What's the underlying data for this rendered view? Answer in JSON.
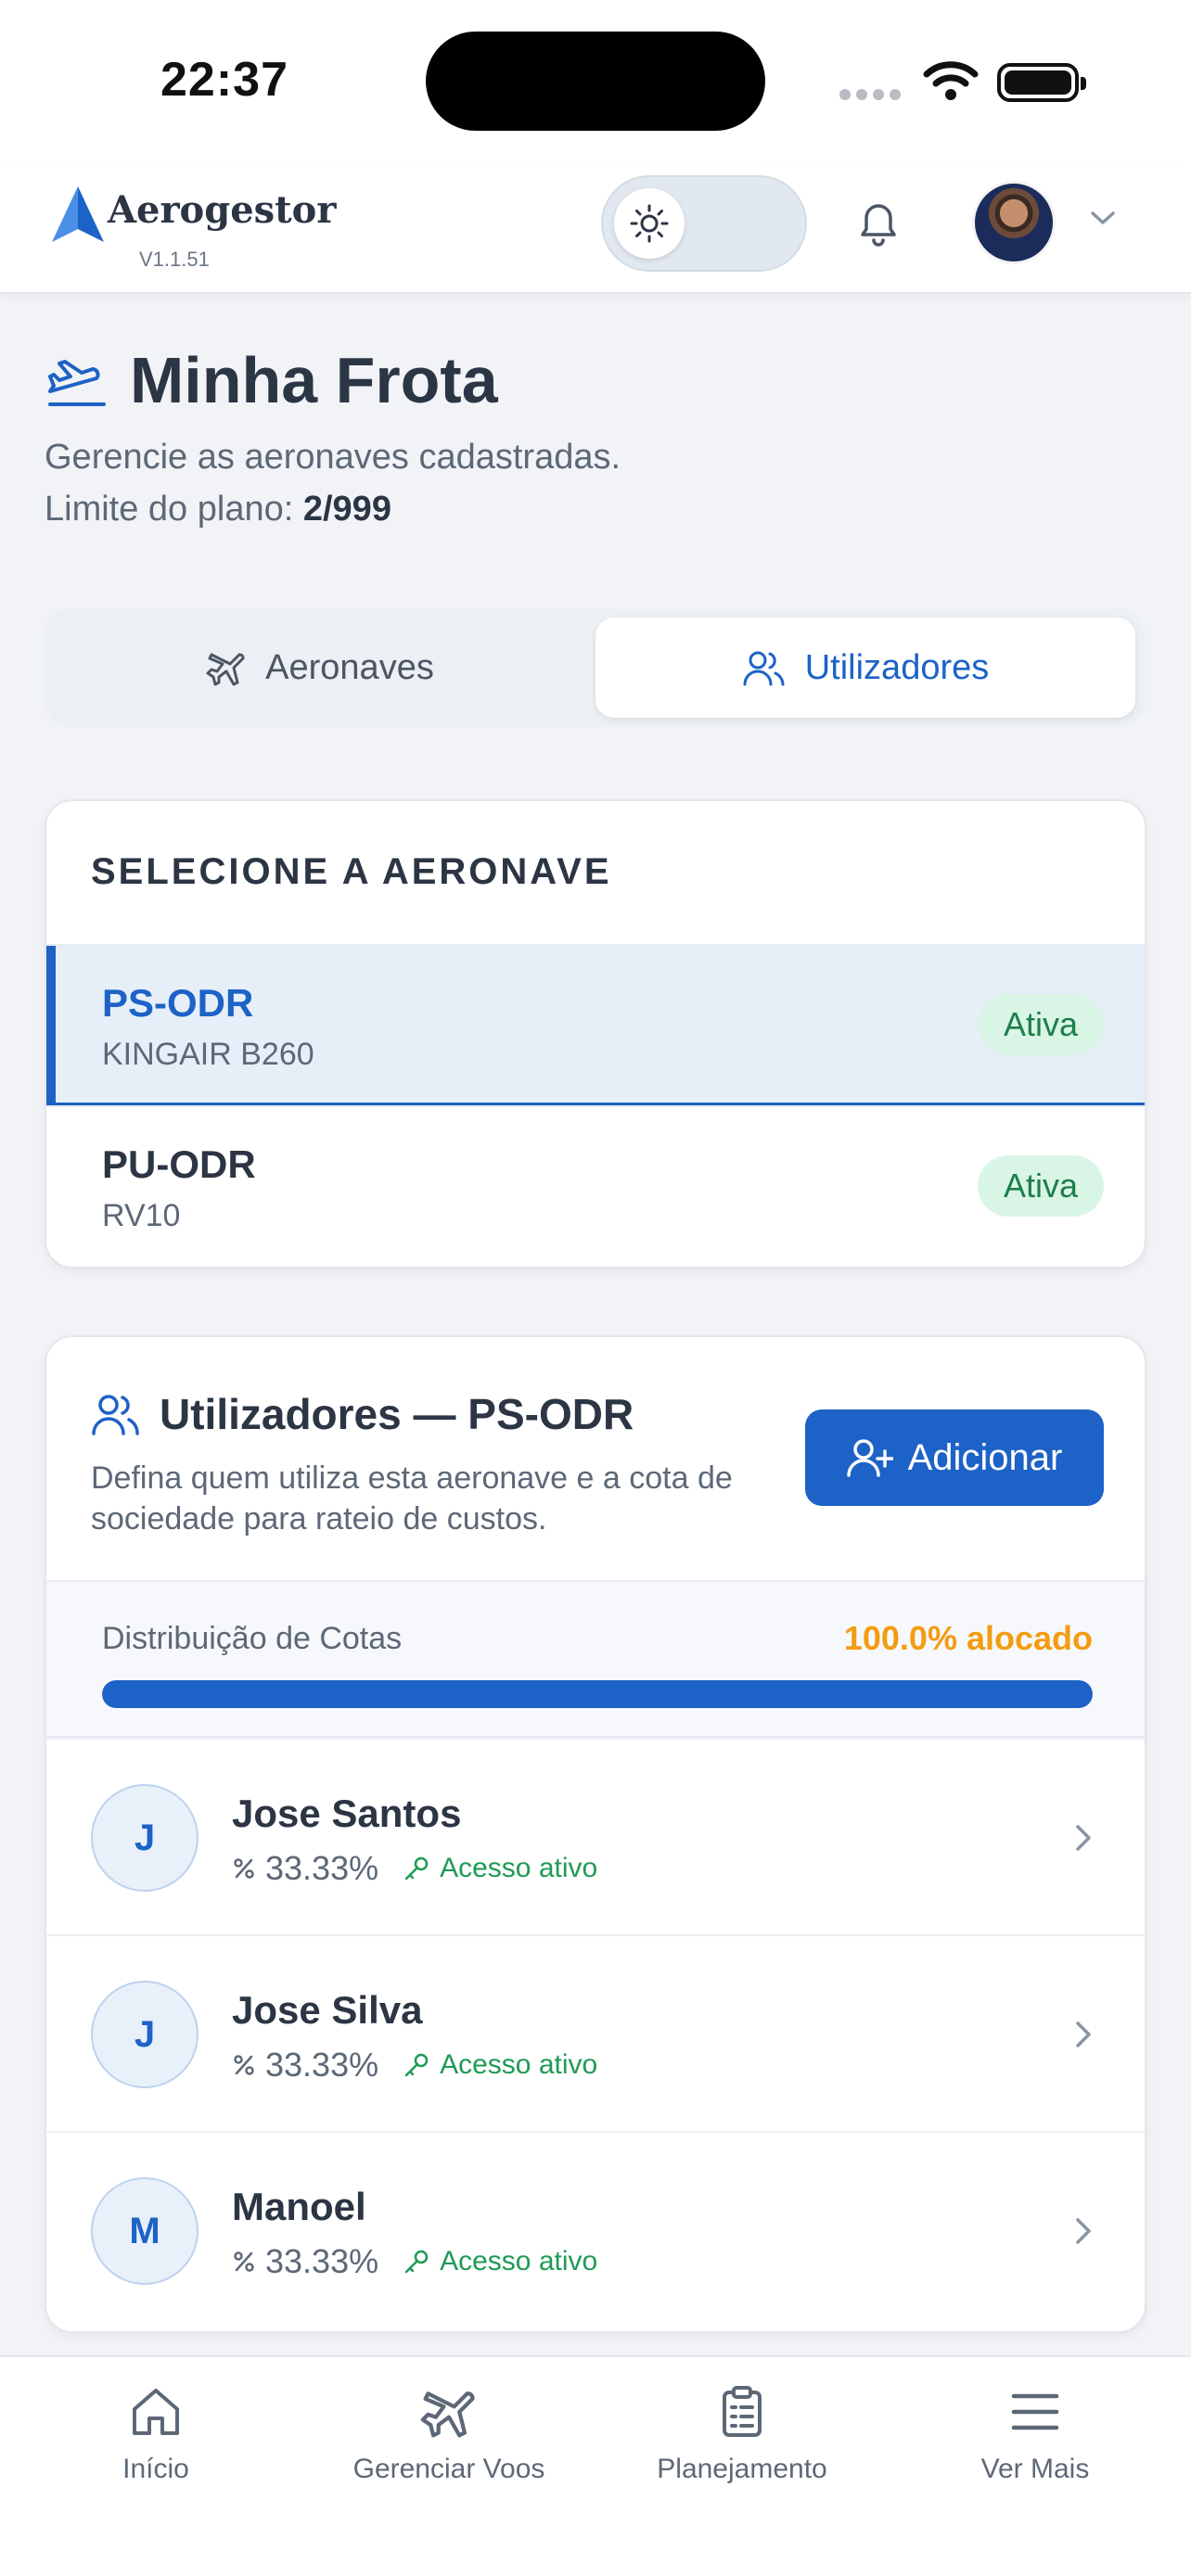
{
  "status_bar": {
    "time": "22:37"
  },
  "app_bar": {
    "brand": "Aerogestor",
    "version": "V1.1.51"
  },
  "page": {
    "title": "Minha Frota",
    "subtitle": "Gerencie as aeronaves cadastradas.",
    "limit_label": "Limite do plano:",
    "limit_value": "2/999"
  },
  "tabs": [
    {
      "label": "Aeronaves",
      "active": false
    },
    {
      "label": "Utilizadores",
      "active": true
    }
  ],
  "aircraft_section": {
    "title": "SELECIONE A AERONAVE",
    "items": [
      {
        "registration": "PS-ODR",
        "model": "KINGAIR B260",
        "status": "Ativa",
        "selected": true
      },
      {
        "registration": "PU-ODR",
        "model": "RV10",
        "status": "Ativa",
        "selected": false
      }
    ]
  },
  "users_section": {
    "title": "Utilizadores — PS-ODR",
    "description": "Defina quem utiliza esta aeronave e a cota de sociedade para rateio de custos.",
    "add_label": "Adicionar",
    "quota_label": "Distribuição de Cotas",
    "quota_value": "100.0% alocado",
    "quota_fraction": 1.0,
    "users": [
      {
        "initial": "J",
        "name": "Jose Santos",
        "share": "33.33%",
        "access": "Acesso ativo"
      },
      {
        "initial": "J",
        "name": "Jose Silva",
        "share": "33.33%",
        "access": "Acesso ativo"
      },
      {
        "initial": "M",
        "name": "Manoel",
        "share": "33.33%",
        "access": "Acesso ativo"
      }
    ]
  },
  "bottom_nav": [
    {
      "label": "Início",
      "icon": "home-icon"
    },
    {
      "label": "Gerenciar Voos",
      "icon": "plane-icon"
    },
    {
      "label": "Planejamento",
      "icon": "clipboard-icon"
    },
    {
      "label": "Ver Mais",
      "icon": "menu-icon"
    }
  ],
  "colors": {
    "accent": "#1d62c6",
    "success": "#1e9a55",
    "warning": "#f39c12",
    "background": "#f1f3f6"
  }
}
